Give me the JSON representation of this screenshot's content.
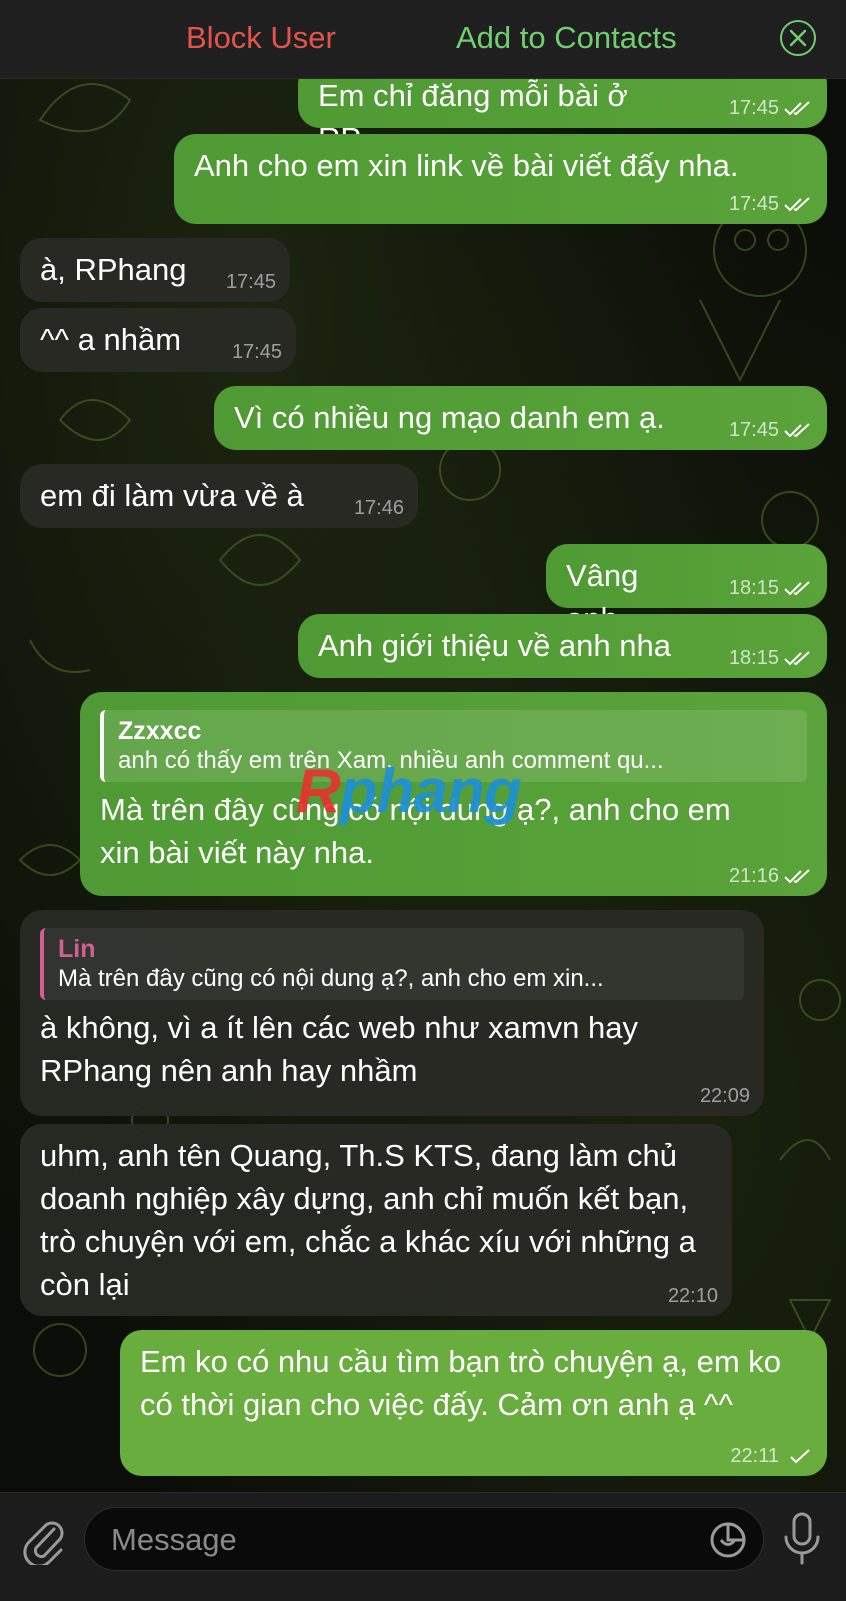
{
  "header": {
    "block_label": "Block User",
    "add_label": "Add to Contacts",
    "close_icon": "close-icon"
  },
  "colors": {
    "outgoing_bubble": "#55a038",
    "incoming_bubble": "#2a2d26",
    "block_red": "#e5534b",
    "add_green": "#6fcf6f",
    "reply_incoming_name": "#d35e95"
  },
  "messages": [
    {
      "dir": "out",
      "text": "Em chỉ đăng mỗi bài ở RP",
      "time": "17:45",
      "status": "read"
    },
    {
      "dir": "out",
      "text": "Anh cho em xin link về bài viết đấy nha.",
      "time": "17:45",
      "status": "read"
    },
    {
      "dir": "in",
      "text": "à, RPhang",
      "time": "17:45"
    },
    {
      "dir": "in",
      "text": "^^ a nhầm",
      "time": "17:45"
    },
    {
      "dir": "out",
      "text": "Vì có nhiều ng mạo danh em ạ.",
      "time": "17:45",
      "status": "read"
    },
    {
      "dir": "in",
      "text": "em đi làm vừa về à",
      "time": "17:46"
    },
    {
      "dir": "out",
      "text": "Vâng anh",
      "time": "18:15",
      "status": "read"
    },
    {
      "dir": "out",
      "text": "Anh giới thiệu về anh nha",
      "time": "18:15",
      "status": "read"
    },
    {
      "dir": "out",
      "reply_name": "Zzxxcc",
      "reply_text": "anh có thấy em trên Xam, nhiều anh comment qu...",
      "text": "Mà trên đây cũng có nội dung ạ?, anh cho em xin bài viết này nha.",
      "time": "21:16",
      "status": "read"
    },
    {
      "dir": "in",
      "reply_name": "Lin",
      "reply_text": "Mà trên đây cũng có nội dung ạ?, anh cho em xin...",
      "text": "à không, vì a ít lên các web như xamvn hay RPhang nên anh hay nhầm",
      "time": "22:09"
    },
    {
      "dir": "in",
      "text": "uhm, anh tên Quang, Th.S KTS, đang làm chủ doanh nghiệp xây dựng, anh chỉ muốn kết bạn, trò chuyện với em, chắc a khác xíu với những a còn lại",
      "time": "22:10"
    },
    {
      "dir": "out",
      "text": "Em ko có nhu cầu tìm bạn trò chuyện ạ, em ko có thời gian cho việc đấy. Cảm ơn anh ạ ^^",
      "time": "22:11",
      "status": "sent"
    }
  ],
  "watermark": {
    "part1": "R",
    "part2": "phang"
  },
  "composer": {
    "placeholder": "Message",
    "attach_icon": "paperclip-icon",
    "sticker_icon": "sticker-icon",
    "mic_icon": "microphone-icon"
  }
}
